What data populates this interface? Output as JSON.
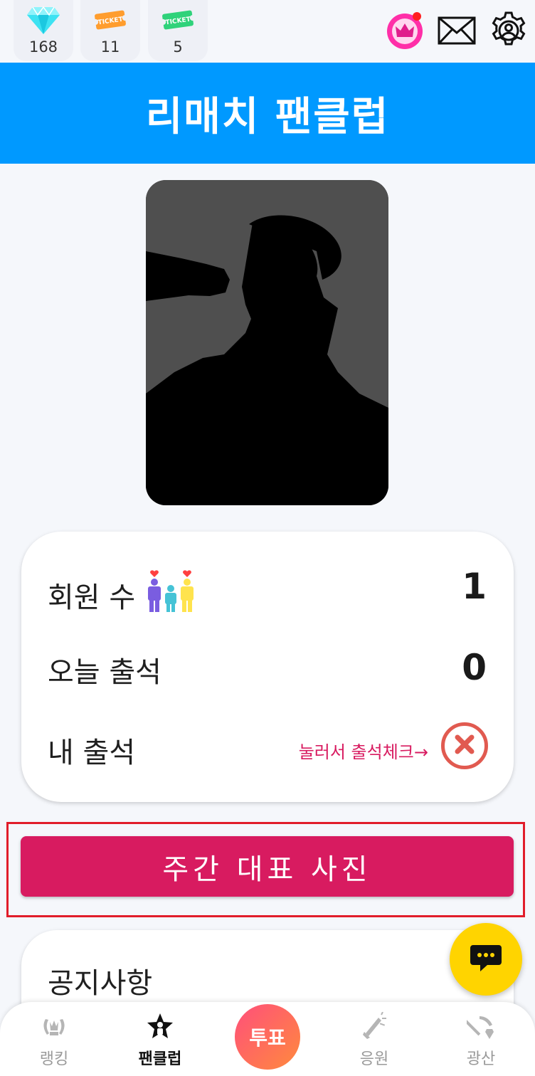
{
  "currencies": [
    {
      "icon": "diamond-icon",
      "value": "168"
    },
    {
      "icon": "ticket-orange-icon",
      "value": "11",
      "badge_text": "TICKET"
    },
    {
      "icon": "ticket-green-icon",
      "value": "5",
      "badge_text": "TICKET"
    }
  ],
  "top_icons": [
    "crown-icon",
    "mail-icon",
    "settings-icon"
  ],
  "header": {
    "title": "리매치 팬클럽",
    "bg_color": "#0099ff"
  },
  "stats": {
    "members_label": "회원 수",
    "members_value": "1",
    "today_label": "오늘 출석",
    "today_value": "0",
    "my_label": "내 출석",
    "checkin_hint": "눌러서 출석체크→"
  },
  "weekly_button": {
    "label": "주간 대표 사진",
    "color": "#d81b60"
  },
  "notice": {
    "title": "공지사항"
  },
  "nav": {
    "ranking": "랭킹",
    "fanclub": "팬클럽",
    "vote": "투표",
    "support": "응원",
    "mine": "광산"
  }
}
